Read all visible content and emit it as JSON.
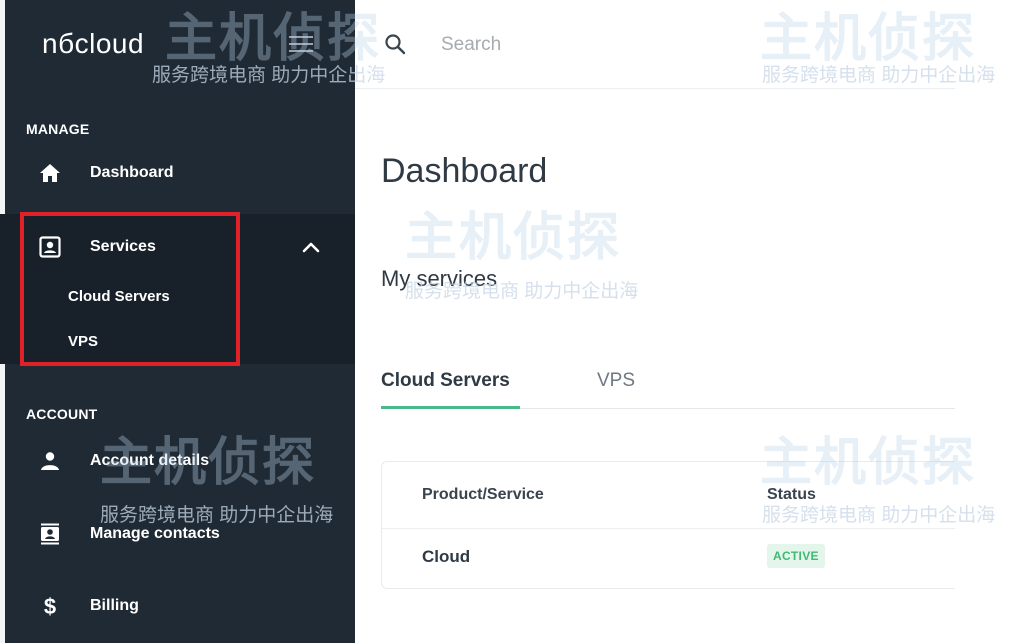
{
  "brand": {
    "logo_text": "nбcloud"
  },
  "search": {
    "placeholder": "Search"
  },
  "sidebar": {
    "manage_label": "MANAGE",
    "account_label": "ACCOUNT",
    "items": [
      {
        "label": "Dashboard",
        "icon": "home-icon"
      },
      {
        "label": "Services",
        "icon": "contact-card-icon"
      },
      {
        "label": "Account details",
        "icon": "user-icon"
      },
      {
        "label": "Manage contacts",
        "icon": "contacts-book-icon"
      },
      {
        "label": "Billing",
        "icon": "dollar-icon"
      }
    ],
    "services_sub": [
      "Cloud Servers",
      "VPS"
    ]
  },
  "main": {
    "page_title": "Dashboard",
    "section_title": "My services",
    "tabs": [
      {
        "label": "Cloud Servers",
        "active": true
      },
      {
        "label": "VPS",
        "active": false
      }
    ],
    "table": {
      "columns": [
        "Product/Service",
        "Status"
      ],
      "rows": [
        {
          "product": "Cloud",
          "status": "ACTIVE"
        }
      ]
    }
  },
  "watermark": {
    "brand_text": "主机侦探",
    "slogan": "服务跨境电商 助力中企出海"
  },
  "colors": {
    "sidebar_bg": "#1f2a34",
    "accent_green": "#49b98a",
    "highlight_red": "#e02127",
    "badge_bg": "#e4f6ec",
    "badge_text": "#3dbb73"
  }
}
